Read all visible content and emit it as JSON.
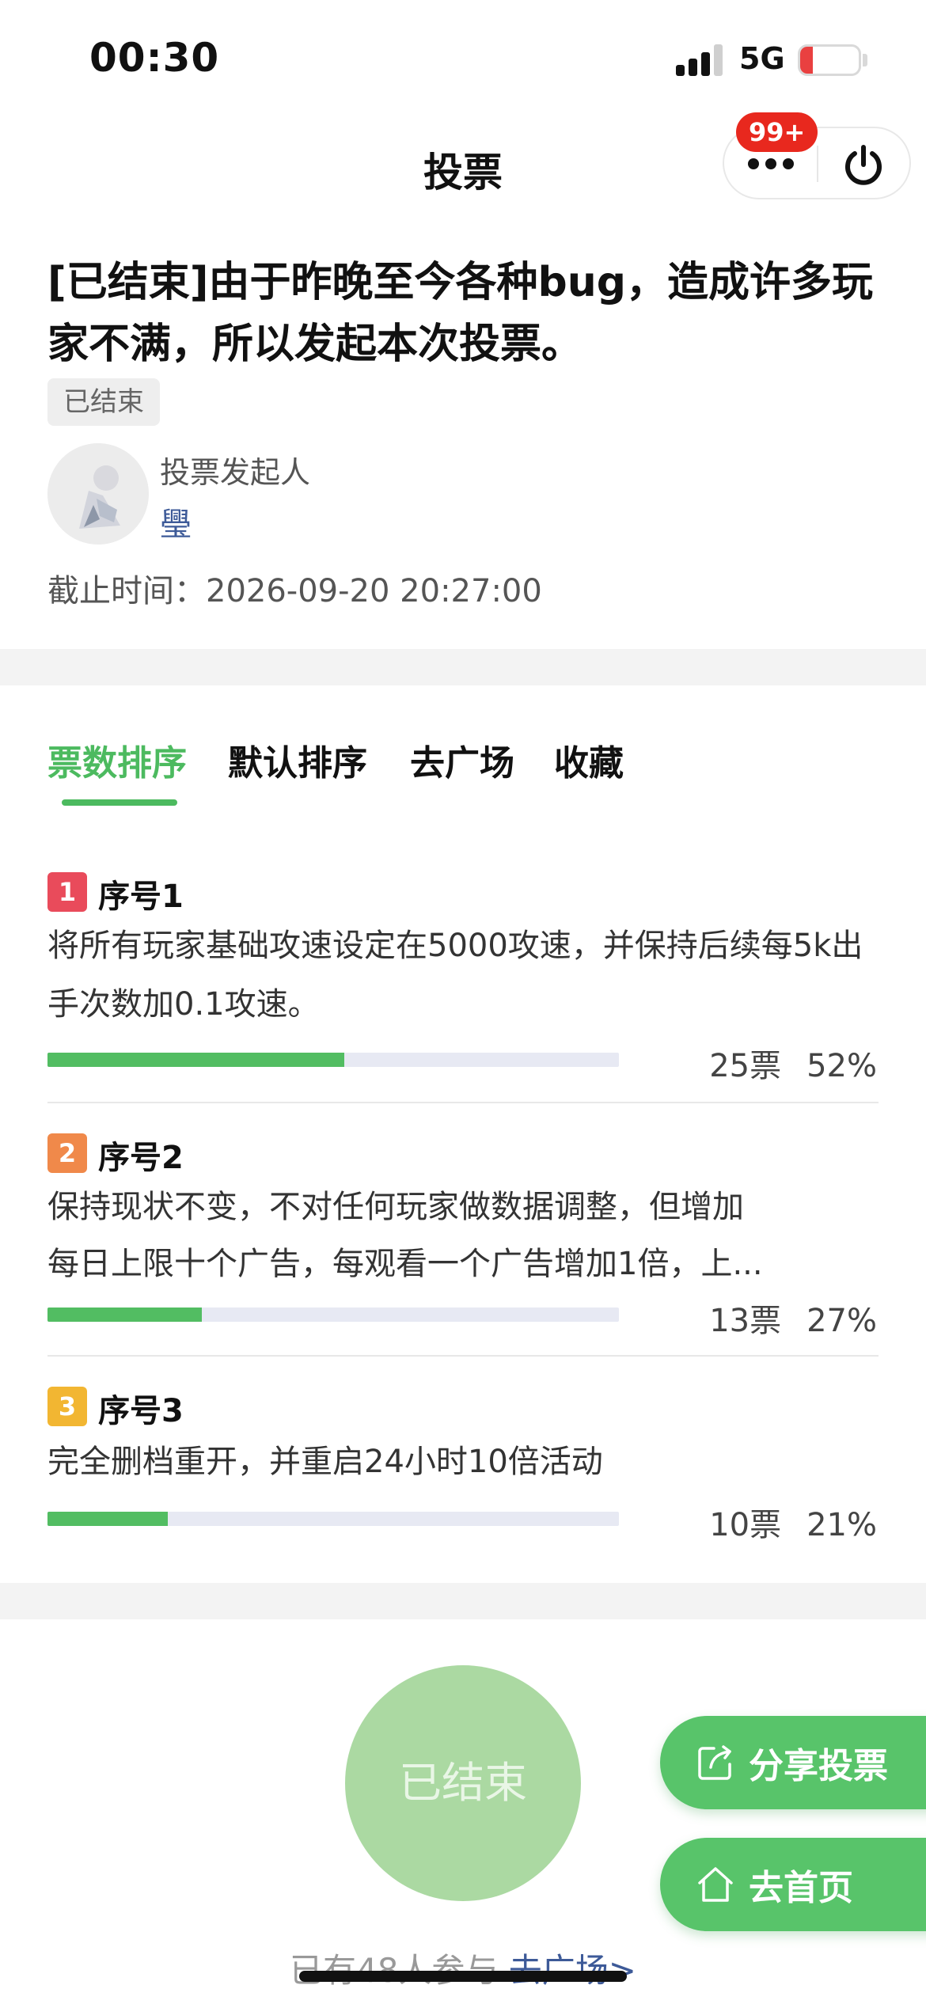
{
  "status_bar": {
    "time": "00:30",
    "network": "5G",
    "battery": "4"
  },
  "nav": {
    "title": "投票",
    "notification_badge": "99+"
  },
  "vote": {
    "title": "[已结束]由于昨晚至今各种bug，造成许多玩家不满，所以发起本次投票。",
    "status_tag": "已结束",
    "initiator_label": "投票发起人",
    "initiator_name": "璺",
    "deadline": "截止时间：2026-09-20 20:27:00"
  },
  "tabs": [
    {
      "label": "票数排序",
      "active": true
    },
    {
      "label": "默认排序",
      "active": false
    },
    {
      "label": "去广场",
      "active": false
    },
    {
      "label": "收藏",
      "active": false
    }
  ],
  "options": [
    {
      "rank": "1",
      "name": "序号1",
      "text": "将所有玩家基础攻速设定在5000攻速，并保持后续每5k出手次数加0.1攻速。",
      "votes": "25票",
      "percent": "52%",
      "share": 0.52,
      "color": "#e94b5b"
    },
    {
      "rank": "2",
      "name": "序号2",
      "text_line1": "保持现状不变，不对任何玩家做数据调整，但增加",
      "text_line2": "每日上限十个广告，每观看一个广告增加1倍，上...",
      "votes": "13票",
      "percent": "27%",
      "share": 0.27,
      "color": "#f0894a"
    },
    {
      "rank": "3",
      "name": "序号3",
      "text": "完全删档重开，并重启24小时10倍活动",
      "votes": "10票",
      "percent": "21%",
      "share": 0.21,
      "color": "#f2b632"
    }
  ],
  "actions": {
    "ended_button": "已结束",
    "share_vote": "分享投票",
    "go_home": "去首页"
  },
  "footer": {
    "participants": "已有48人参与",
    "link": "去广场>"
  },
  "colors": {
    "accent_green": "#4cba5f",
    "badge_red": "#e8281e",
    "link_blue": "#3d5a98"
  }
}
